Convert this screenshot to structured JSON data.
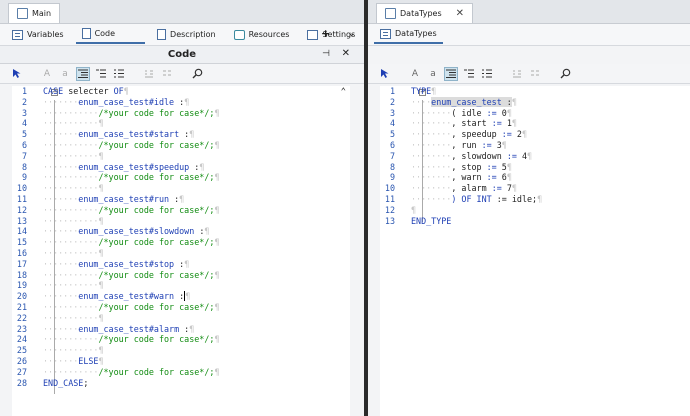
{
  "left_tab": {
    "label": "Main"
  },
  "right_tab": {
    "label": "DataTypes",
    "close": "✕"
  },
  "left_views": [
    {
      "label": "Variables",
      "icon": "grid-icon"
    },
    {
      "label": "Code",
      "icon": "document-icon"
    },
    {
      "label": "Description",
      "icon": "page-icon"
    },
    {
      "label": "Resources",
      "icon": "resources-icon"
    },
    {
      "label": "Settings",
      "icon": "settings-icon"
    }
  ],
  "left_plus": "+",
  "left_chevron": "⌄",
  "right_view": {
    "label": "DataTypes"
  },
  "editor": {
    "title": "Code",
    "pin": "⊣",
    "close": "✕"
  },
  "toolbar_icons": [
    "cursor-icon",
    "font-larger-icon",
    "font-smaller-icon",
    "indent-icon",
    "list-icon",
    "list-numbered-icon",
    "bookmark-icon",
    "bookmark-next-icon",
    "search-icon"
  ],
  "toolbar_glyphs": {
    "A": "A",
    "a": "a"
  },
  "left_code": [
    {
      "n": "1",
      "parts": [
        {
          "c": "kw",
          "t": "CASE"
        },
        {
          "c": "pl",
          "t": " selecter "
        },
        {
          "c": "kw",
          "t": "OF"
        },
        {
          "c": "pil",
          "t": "¶"
        }
      ]
    },
    {
      "n": "2",
      "parts": [
        {
          "c": "pil",
          "t": "·······"
        },
        {
          "c": "id",
          "t": "enum_case_test#idle"
        },
        {
          "c": "pl",
          "t": " :"
        },
        {
          "c": "pil",
          "t": "¶"
        }
      ]
    },
    {
      "n": "3",
      "parts": [
        {
          "c": "pil",
          "t": "···········"
        },
        {
          "c": "cm",
          "t": "/*your code for case*/;"
        },
        {
          "c": "pil",
          "t": "¶"
        }
      ]
    },
    {
      "n": "4",
      "parts": [
        {
          "c": "pil",
          "t": "···········¶"
        }
      ]
    },
    {
      "n": "5",
      "parts": [
        {
          "c": "pil",
          "t": "·······"
        },
        {
          "c": "id",
          "t": "enum_case_test#start"
        },
        {
          "c": "pl",
          "t": " :"
        },
        {
          "c": "pil",
          "t": "¶"
        }
      ]
    },
    {
      "n": "6",
      "parts": [
        {
          "c": "pil",
          "t": "···········"
        },
        {
          "c": "cm",
          "t": "/*your code for case*/;"
        },
        {
          "c": "pil",
          "t": "¶"
        }
      ]
    },
    {
      "n": "7",
      "parts": [
        {
          "c": "pil",
          "t": "···········¶"
        }
      ]
    },
    {
      "n": "8",
      "parts": [
        {
          "c": "pil",
          "t": "·······"
        },
        {
          "c": "id",
          "t": "enum_case_test#speedup"
        },
        {
          "c": "pl",
          "t": " :"
        },
        {
          "c": "pil",
          "t": "¶"
        }
      ]
    },
    {
      "n": "9",
      "parts": [
        {
          "c": "pil",
          "t": "···········"
        },
        {
          "c": "cm",
          "t": "/*your code for case*/;"
        },
        {
          "c": "pil",
          "t": "¶"
        }
      ]
    },
    {
      "n": "10",
      "parts": [
        {
          "c": "pil",
          "t": "···········¶"
        }
      ]
    },
    {
      "n": "11",
      "parts": [
        {
          "c": "pil",
          "t": "·······"
        },
        {
          "c": "id",
          "t": "enum_case_test#run"
        },
        {
          "c": "pl",
          "t": " :"
        },
        {
          "c": "pil",
          "t": "¶"
        }
      ]
    },
    {
      "n": "12",
      "parts": [
        {
          "c": "pil",
          "t": "···········"
        },
        {
          "c": "cm",
          "t": "/*your code for case*/;"
        },
        {
          "c": "pil",
          "t": "¶"
        }
      ]
    },
    {
      "n": "13",
      "parts": [
        {
          "c": "pil",
          "t": "···········¶"
        }
      ]
    },
    {
      "n": "14",
      "parts": [
        {
          "c": "pil",
          "t": "·······"
        },
        {
          "c": "id",
          "t": "enum_case_test#slowdown"
        },
        {
          "c": "pl",
          "t": " :"
        },
        {
          "c": "pil",
          "t": "¶"
        }
      ]
    },
    {
      "n": "15",
      "parts": [
        {
          "c": "pil",
          "t": "···········"
        },
        {
          "c": "cm",
          "t": "/*your code for case*/;"
        },
        {
          "c": "pil",
          "t": "¶"
        }
      ]
    },
    {
      "n": "16",
      "parts": [
        {
          "c": "pil",
          "t": "···········¶"
        }
      ]
    },
    {
      "n": "17",
      "parts": [
        {
          "c": "pil",
          "t": "·······"
        },
        {
          "c": "id",
          "t": "enum_case_test#stop"
        },
        {
          "c": "pl",
          "t": " :"
        },
        {
          "c": "pil",
          "t": "¶"
        }
      ]
    },
    {
      "n": "18",
      "parts": [
        {
          "c": "pil",
          "t": "···········"
        },
        {
          "c": "cm",
          "t": "/*your code for case*/;"
        },
        {
          "c": "pil",
          "t": "¶"
        }
      ]
    },
    {
      "n": "19",
      "parts": [
        {
          "c": "pil",
          "t": "···········¶"
        }
      ]
    },
    {
      "n": "20",
      "parts": [
        {
          "c": "pil",
          "t": "·······"
        },
        {
          "c": "id",
          "t": "enum_case_test#warn"
        },
        {
          "c": "pl",
          "t": " :"
        },
        {
          "c": "pil caret",
          "t": "¶"
        }
      ]
    },
    {
      "n": "21",
      "parts": [
        {
          "c": "pil",
          "t": "···········"
        },
        {
          "c": "cm",
          "t": "/*your code for case*/;"
        },
        {
          "c": "pil",
          "t": "¶"
        }
      ]
    },
    {
      "n": "22",
      "parts": [
        {
          "c": "pil",
          "t": "···········¶"
        }
      ]
    },
    {
      "n": "23",
      "parts": [
        {
          "c": "pil",
          "t": "·······"
        },
        {
          "c": "id",
          "t": "enum_case_test#alarm"
        },
        {
          "c": "pl",
          "t": " :"
        },
        {
          "c": "pil",
          "t": "¶"
        }
      ]
    },
    {
      "n": "24",
      "parts": [
        {
          "c": "pil",
          "t": "···········"
        },
        {
          "c": "cm",
          "t": "/*your code for case*/;"
        },
        {
          "c": "pil",
          "t": "¶"
        }
      ]
    },
    {
      "n": "25",
      "parts": [
        {
          "c": "pil",
          "t": "···········¶"
        }
      ]
    },
    {
      "n": "26",
      "parts": [
        {
          "c": "pil",
          "t": "·······"
        },
        {
          "c": "kw",
          "t": "ELSE"
        },
        {
          "c": "pil",
          "t": "¶"
        }
      ]
    },
    {
      "n": "27",
      "parts": [
        {
          "c": "pil",
          "t": "···········"
        },
        {
          "c": "cm",
          "t": "/*your code for case*/;"
        },
        {
          "c": "pil",
          "t": "¶"
        }
      ]
    },
    {
      "n": "28",
      "parts": [
        {
          "c": "kw",
          "t": "END_CASE"
        },
        {
          "c": "pl",
          "t": ";"
        }
      ]
    }
  ],
  "right_code": [
    {
      "n": "1",
      "parts": [
        {
          "c": "kw",
          "t": "TYPE"
        },
        {
          "c": "pil",
          "t": "¶"
        }
      ]
    },
    {
      "n": "2",
      "parts": [
        {
          "c": "pil",
          "t": "····"
        },
        {
          "c": "id hl",
          "t": "enum_case_test"
        },
        {
          "c": "pl hl",
          "t": " :"
        },
        {
          "c": "pil",
          "t": "¶"
        }
      ]
    },
    {
      "n": "3",
      "parts": [
        {
          "c": "pil",
          "t": "········"
        },
        {
          "c": "pl",
          "t": "( idle "
        },
        {
          "c": "id",
          "t": ":="
        },
        {
          "c": "pl",
          "t": " 0"
        },
        {
          "c": "pil",
          "t": "¶"
        }
      ]
    },
    {
      "n": "4",
      "parts": [
        {
          "c": "pil",
          "t": "········"
        },
        {
          "c": "pl",
          "t": ", start "
        },
        {
          "c": "id",
          "t": ":="
        },
        {
          "c": "pl",
          "t": " 1"
        },
        {
          "c": "pil",
          "t": "¶"
        }
      ]
    },
    {
      "n": "5",
      "parts": [
        {
          "c": "pil",
          "t": "········"
        },
        {
          "c": "pl",
          "t": ", speedup "
        },
        {
          "c": "id",
          "t": ":="
        },
        {
          "c": "pl",
          "t": " 2"
        },
        {
          "c": "pil",
          "t": "¶"
        }
      ]
    },
    {
      "n": "6",
      "parts": [
        {
          "c": "pil",
          "t": "········"
        },
        {
          "c": "pl",
          "t": ", run "
        },
        {
          "c": "id",
          "t": ":="
        },
        {
          "c": "pl",
          "t": " 3"
        },
        {
          "c": "pil",
          "t": "¶"
        }
      ]
    },
    {
      "n": "7",
      "parts": [
        {
          "c": "pil",
          "t": "········"
        },
        {
          "c": "pl",
          "t": ", slowdown "
        },
        {
          "c": "id",
          "t": ":="
        },
        {
          "c": "pl",
          "t": " 4"
        },
        {
          "c": "pil",
          "t": "¶"
        }
      ]
    },
    {
      "n": "8",
      "parts": [
        {
          "c": "pil",
          "t": "········"
        },
        {
          "c": "pl",
          "t": ", stop "
        },
        {
          "c": "id",
          "t": ":="
        },
        {
          "c": "pl",
          "t": " 5"
        },
        {
          "c": "pil",
          "t": "¶"
        }
      ]
    },
    {
      "n": "9",
      "parts": [
        {
          "c": "pil",
          "t": "········"
        },
        {
          "c": "pl",
          "t": ", warn "
        },
        {
          "c": "id",
          "t": ":="
        },
        {
          "c": "pl",
          "t": " 6"
        },
        {
          "c": "pil",
          "t": "¶"
        }
      ]
    },
    {
      "n": "10",
      "parts": [
        {
          "c": "pil",
          "t": "········"
        },
        {
          "c": "pl",
          "t": ", alarm "
        },
        {
          "c": "id",
          "t": ":="
        },
        {
          "c": "pl",
          "t": " 7"
        },
        {
          "c": "pil",
          "t": "¶"
        }
      ]
    },
    {
      "n": "11",
      "parts": [
        {
          "c": "pil",
          "t": "········"
        },
        {
          "c": "kw",
          "t": ") OF INT"
        },
        {
          "c": "pl",
          "t": " := idle;"
        },
        {
          "c": "pil",
          "t": "¶"
        }
      ]
    },
    {
      "n": "12",
      "parts": [
        {
          "c": "pil",
          "t": "¶"
        }
      ]
    },
    {
      "n": "13",
      "parts": [
        {
          "c": "kw",
          "t": "END_TYPE"
        }
      ]
    }
  ],
  "scroll_up": "⌃"
}
